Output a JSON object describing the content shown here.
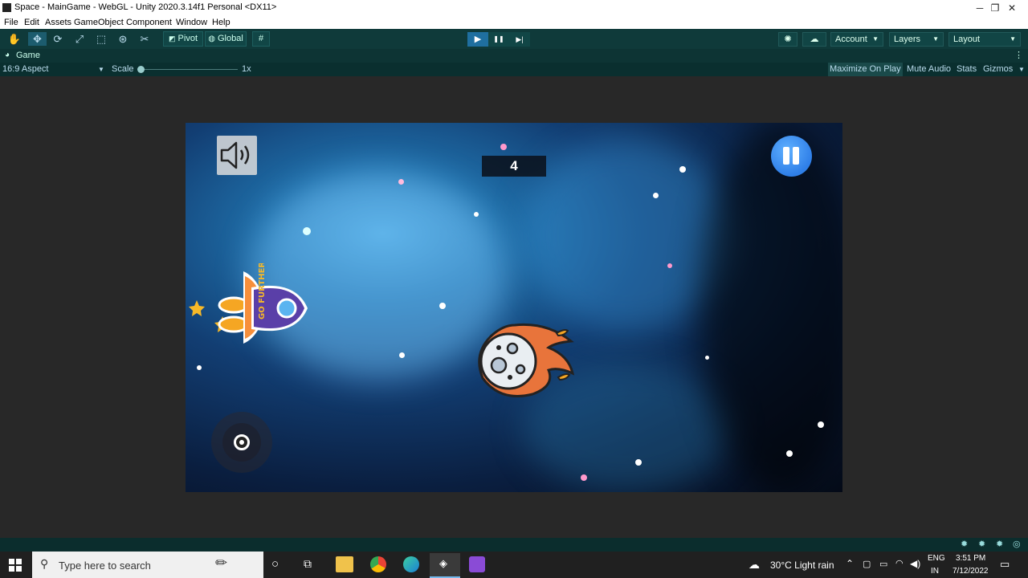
{
  "window": {
    "title": "Space - MainGame - WebGL - Unity 2020.3.14f1 Personal <DX11>",
    "minimize": "─",
    "maximize": "❐",
    "close": "✕"
  },
  "menu": [
    "File",
    "Edit",
    "Assets",
    "GameObject",
    "Component",
    "Window",
    "Help"
  ],
  "toolbar": {
    "pivot": "Pivot",
    "global": "Global",
    "account": "Account",
    "layers": "Layers",
    "layout": "Layout",
    "play": "▶",
    "pause": "❚❚",
    "step": "▶|"
  },
  "game_tab": {
    "label": "Game",
    "aspect": "16:9 Aspect",
    "scale_label": "Scale",
    "scale_value": "1x",
    "scale_level": 0.0,
    "maximize_on_play": "Maximize On Play",
    "mute_audio": "Mute Audio",
    "stats": "Stats",
    "gizmos": "Gizmos"
  },
  "game": {
    "score": "4",
    "rocket_text": "GO FURTHER"
  },
  "taskbar": {
    "search_placeholder": "Type here to search",
    "weather": "30°C  Light rain",
    "lang_top": "ENG",
    "lang_bottom": "IN",
    "time": "3:51 PM",
    "date": "7/12/2022"
  },
  "colors": {
    "unity_toolbar": "#0f3a3a",
    "play_active": "#1f6fa0",
    "pause_button": "#2f7fe8"
  }
}
